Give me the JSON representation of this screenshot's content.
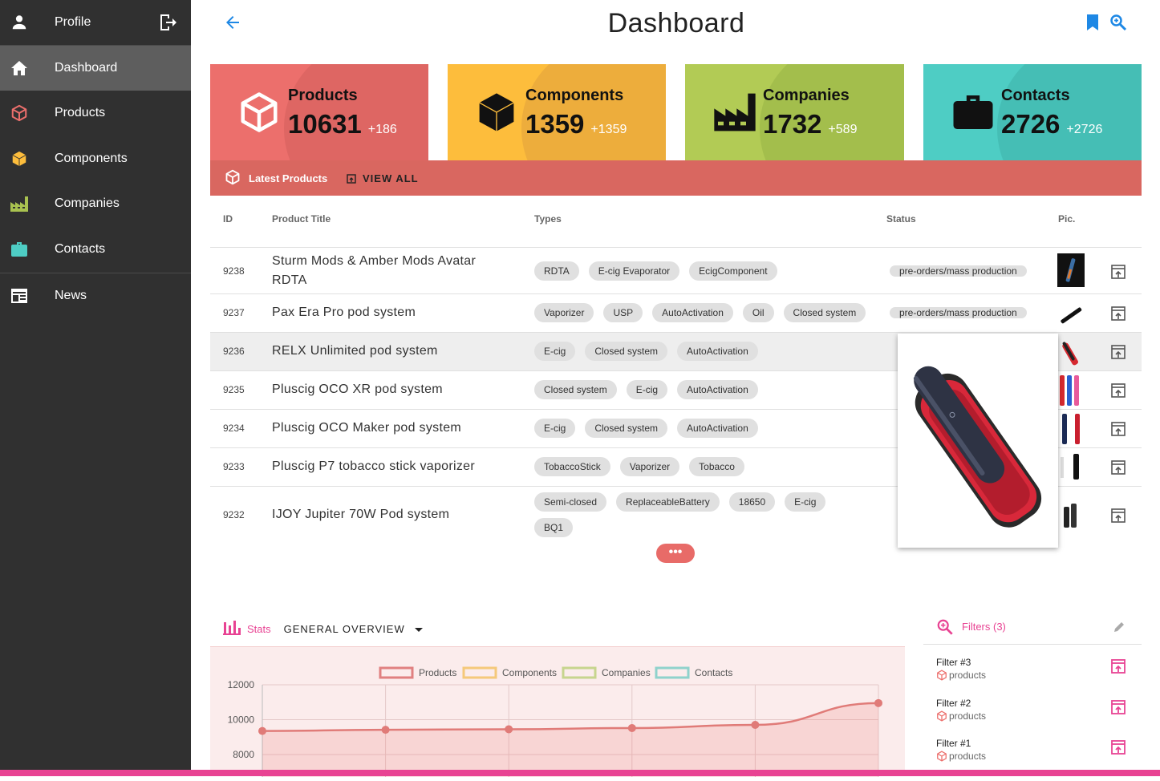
{
  "sidebar": {
    "profile": "Profile",
    "items": [
      {
        "label": "Dashboard",
        "icon": "home-icon",
        "color": "#ffffff"
      },
      {
        "label": "Products",
        "icon": "cube-outline-icon",
        "color": "#ec6f6c"
      },
      {
        "label": "Components",
        "icon": "cube-icon",
        "color": "#fdbd3c"
      },
      {
        "label": "Companies",
        "icon": "factory-icon",
        "color": "#a9c250"
      },
      {
        "label": "Contacts",
        "icon": "briefcase-icon",
        "color": "#4ecdc4"
      },
      {
        "label": "News",
        "icon": "newspaper-icon",
        "color": "#ffffff"
      }
    ]
  },
  "header": {
    "title": "Dashboard"
  },
  "cards": [
    {
      "name": "Products",
      "value": "10631",
      "delta": "+186",
      "color": "#ec6f6c"
    },
    {
      "name": "Components",
      "value": "1359",
      "delta": "+1359",
      "color": "#fdbd3c"
    },
    {
      "name": "Companies",
      "value": "1732",
      "delta": "+589",
      "color": "#b2cb55"
    },
    {
      "name": "Contacts",
      "value": "2726",
      "delta": "+2726",
      "color": "#4ecdc4"
    }
  ],
  "latest": {
    "title": "Latest Products",
    "view_all": "VIEW ALL"
  },
  "table": {
    "headers": {
      "id": "ID",
      "title": "Product Title",
      "types": "Types",
      "status": "Status",
      "pic": "Pic."
    },
    "rows": [
      {
        "id": "9238",
        "title": "Sturm Mods & Amber Mods Avatar RDTA",
        "types": [
          "RDTA",
          "E-cig Evaporator",
          "EcigComponent"
        ],
        "status": "pre-orders/mass production"
      },
      {
        "id": "9237",
        "title": "Pax Era Pro pod system",
        "types": [
          "Vaporizer",
          "USP",
          "AutoActivation",
          "Oil",
          "Closed system"
        ],
        "status": "pre-orders/mass production"
      },
      {
        "id": "9236",
        "title": "RELX Unlimited pod system",
        "types": [
          "E-cig",
          "Closed system",
          "AutoActivation"
        ],
        "status": ""
      },
      {
        "id": "9235",
        "title": "Pluscig OCO XR pod system",
        "types": [
          "Closed system",
          "E-cig",
          "AutoActivation"
        ],
        "status": ""
      },
      {
        "id": "9234",
        "title": "Pluscig OCO Maker pod system",
        "types": [
          "E-cig",
          "Closed system",
          "AutoActivation"
        ],
        "status": ""
      },
      {
        "id": "9233",
        "title": "Pluscig P7 tobacco stick vaporizer",
        "types": [
          "TobaccoStick",
          "Vaporizer",
          "Tobacco"
        ],
        "status": ""
      },
      {
        "id": "9232",
        "title": "IJOY Jupiter 70W Pod system",
        "types": [
          "Semi-closed",
          "ReplaceableBattery",
          "18650",
          "E-cig",
          "BQ1"
        ],
        "status": ""
      }
    ],
    "more": "•••"
  },
  "stats": {
    "label": "Stats",
    "selector": "GENERAL OVERVIEW"
  },
  "chart_data": {
    "type": "line",
    "title": "",
    "legend": [
      "Products",
      "Components",
      "Companies",
      "Contacts"
    ],
    "legend_colors": [
      "#e08080",
      "#f5c97a",
      "#c7d58e",
      "#8fd2cc"
    ],
    "yticks": [
      "12000",
      "10000",
      "8000"
    ],
    "ylim": [
      8000,
      12000
    ],
    "series": [
      {
        "name": "Products",
        "values": [
          9350,
          9420,
          9450,
          9520,
          9700,
          10950
        ]
      }
    ]
  },
  "filters": {
    "label": "Filters (3)",
    "items": [
      {
        "name": "Filter #3",
        "target": "products"
      },
      {
        "name": "Filter #2",
        "target": "products"
      },
      {
        "name": "Filter #1",
        "target": "products"
      }
    ]
  }
}
